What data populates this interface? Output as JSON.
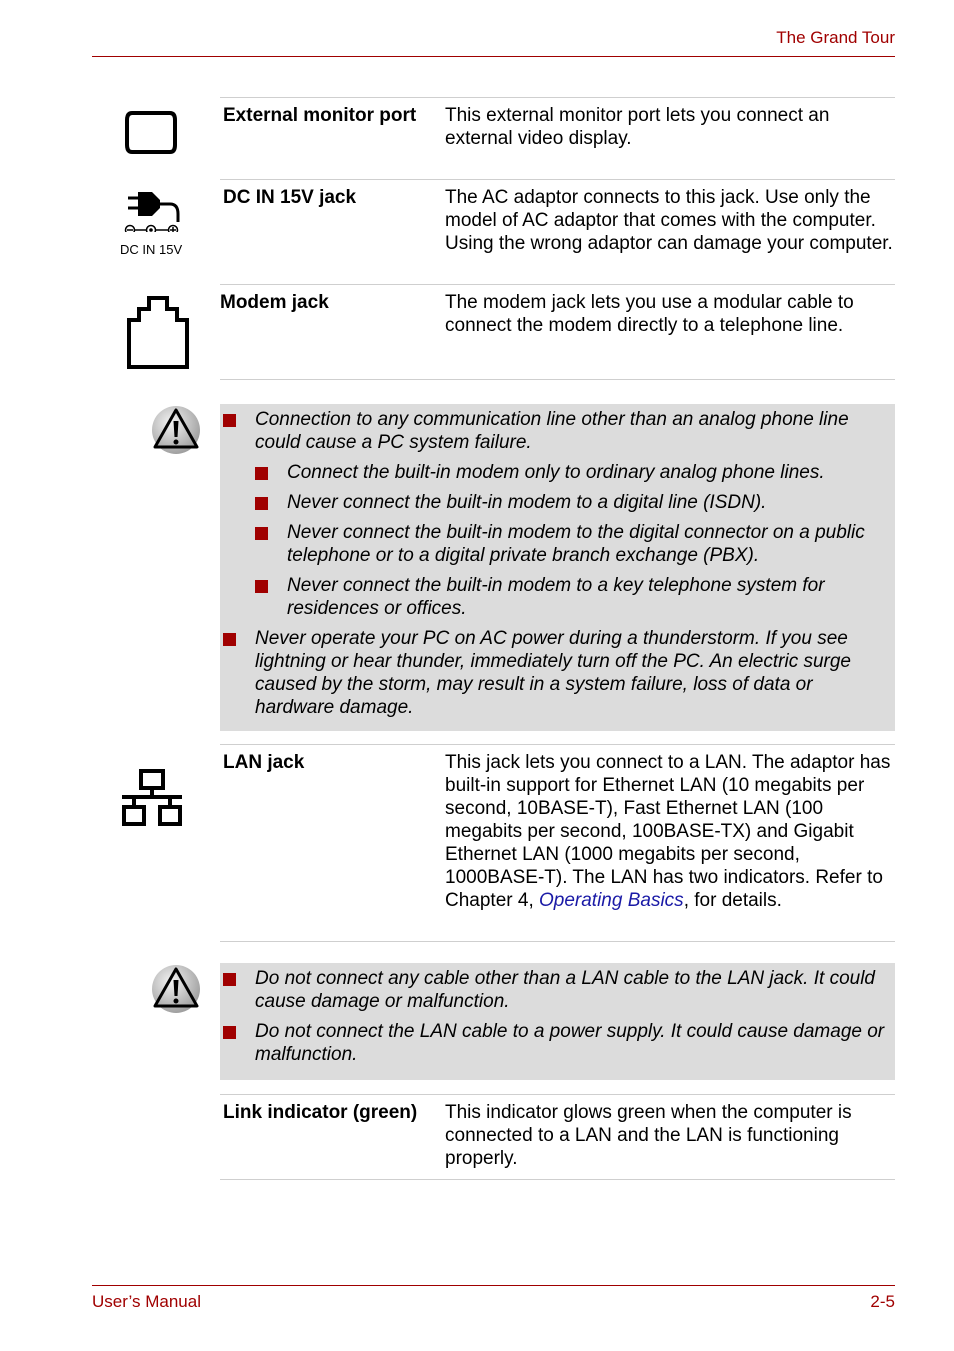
{
  "header": {
    "title": "The Grand Tour"
  },
  "footer": {
    "left": "User’s Manual",
    "right": "2-5"
  },
  "ports": [
    {
      "icon": "external-monitor-icon",
      "term": "External monitor port",
      "desc": "This external monitor port lets you connect an external video display."
    },
    {
      "icon": "dc-in-icon",
      "icon_label": "DC IN 15V",
      "term": "DC IN 15V jack",
      "desc": "The AC adaptor connects to this jack. Use only the model of AC adaptor that comes with the computer. Using the wrong adaptor can damage your computer."
    },
    {
      "icon": "modem-jack-icon",
      "term": "Modem jack",
      "desc": "The modem jack lets you use a modular cable to connect the modem directly to a telephone line."
    }
  ],
  "modem_warning": {
    "icon": "warning-icon",
    "items": [
      {
        "level": 1,
        "text": "Connection to any communication line other than an analog phone line could cause a PC system failure."
      },
      {
        "level": 2,
        "text": "Connect the built-in modem only to ordinary analog phone lines."
      },
      {
        "level": 2,
        "text": "Never connect the built-in modem to a digital line (ISDN)."
      },
      {
        "level": 2,
        "text": "Never connect the built-in modem to the digital connector on a public telephone or to a digital private branch exchange (PBX)."
      },
      {
        "level": 2,
        "text": "Never connect the built-in modem to a key telephone system for residences or offices."
      },
      {
        "level": 1,
        "text": "Never operate your PC on AC power during a thunderstorm. If you see lightning or hear thunder, immediately turn off the PC. An electric surge caused by the storm, may result in a system failure, loss of data or hardware damage."
      }
    ]
  },
  "lan": {
    "icon": "lan-jack-icon",
    "term": "LAN jack",
    "desc_before": "This jack lets you connect to a LAN. The adaptor has built-in support for Ethernet LAN (10 megabits per second, 10BASE-T), Fast Ethernet LAN (100 megabits per second, 100BASE-TX) and Gigabit Ethernet LAN (1000 megabits per second, 1000BASE-T). The LAN has two indicators. Refer to Chapter 4, ",
    "link": "Operating Basics",
    "desc_after": ", for details."
  },
  "lan_warning": {
    "icon": "warning-icon",
    "items": [
      {
        "level": 1,
        "text": "Do not connect any cable other than a LAN cable to the LAN jack. It could cause damage or malfunction."
      },
      {
        "level": 1,
        "text": "Do not connect the LAN cable to a power supply. It could cause damage or malfunction."
      }
    ]
  },
  "link_indicator": {
    "term": "Link indicator (green)",
    "desc": "This indicator glows green when the computer is connected to a LAN and the LAN is functioning properly."
  },
  "colors": {
    "accent": "#a00000",
    "note_bg": "#dcdcdc",
    "link": "#1a1aa6"
  }
}
